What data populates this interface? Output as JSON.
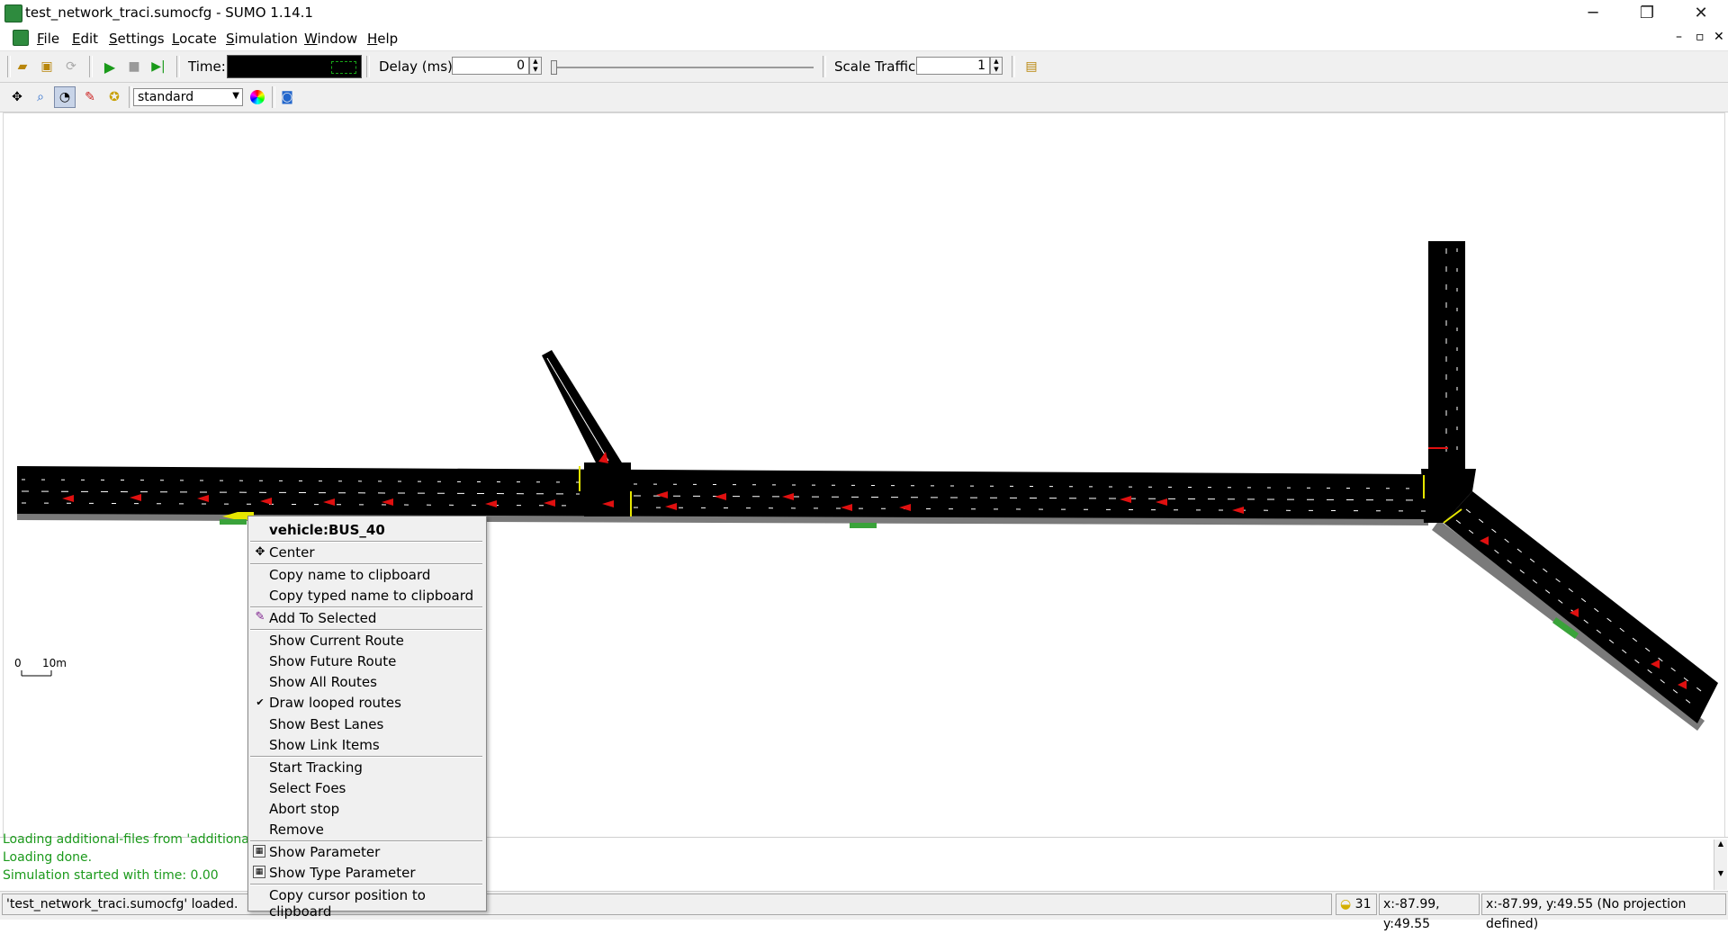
{
  "window": {
    "title": "test_network_traci.sumocfg - SUMO 1.14.1",
    "controls": [
      "─",
      "❐",
      "✕"
    ],
    "mdi_controls": [
      "–",
      "▫",
      "✕"
    ]
  },
  "menubar": {
    "items": [
      {
        "label": "File",
        "key": "F",
        "rest": "ile"
      },
      {
        "label": "Edit",
        "key": "E",
        "rest": "dit"
      },
      {
        "label": "Settings",
        "key": "S",
        "rest": "ettings"
      },
      {
        "label": "Locate",
        "key": "L",
        "rest": "ocate"
      },
      {
        "label": "Simulation",
        "key": "S",
        "rest": "imulation"
      },
      {
        "label": "Window",
        "key": "W",
        "rest": "indow"
      },
      {
        "label": "Help",
        "key": "H",
        "rest": "elp"
      }
    ]
  },
  "toolbar": {
    "time_label": "Time:",
    "time_value": "",
    "delay_label": "Delay (ms):",
    "delay_value": "0",
    "scale_label": "Scale Traffic:",
    "scale_value": "1"
  },
  "viewbar": {
    "scheme": "standard"
  },
  "canvas": {
    "scale_zero": "0",
    "scale_label": "10m"
  },
  "messages": [
    "Loading additional-files from 'additional...",
    "Loading done.",
    "Simulation started with time: 0.00"
  ],
  "status": {
    "text": "'test_network_traci.sumocfg' loaded.",
    "vehicle_count": "31",
    "coords1": "x:-87.99, y:49.55",
    "coords2": "x:-87.99, y:49.55 (No projection defined)"
  },
  "context_menu": {
    "header": "vehicle:BUS_40",
    "items": {
      "center": "Center",
      "copy_name": "Copy name to clipboard",
      "copy_typed_name": "Copy typed name to clipboard",
      "add_selected": "Add To Selected",
      "show_current_route": "Show Current Route",
      "show_future_route": "Show Future Route",
      "show_all_routes": "Show All Routes",
      "draw_looped_routes": "Draw looped routes",
      "show_best_lanes": "Show Best Lanes",
      "show_link_items": "Show Link Items",
      "start_tracking": "Start Tracking",
      "select_foes": "Select Foes",
      "abort_stop": "Abort stop",
      "remove": "Remove",
      "show_parameter": "Show Parameter",
      "show_type_parameter": "Show Type Parameter",
      "copy_cursor_position": "Copy cursor position to clipboard"
    },
    "checked": "✔"
  },
  "colors": {
    "road": "#000000",
    "vehicle": "#e01010",
    "bus": "#e6e600",
    "stop": "#3aa33a",
    "sidewalk": "#7a7a7a",
    "message": "#1c9a1c"
  }
}
